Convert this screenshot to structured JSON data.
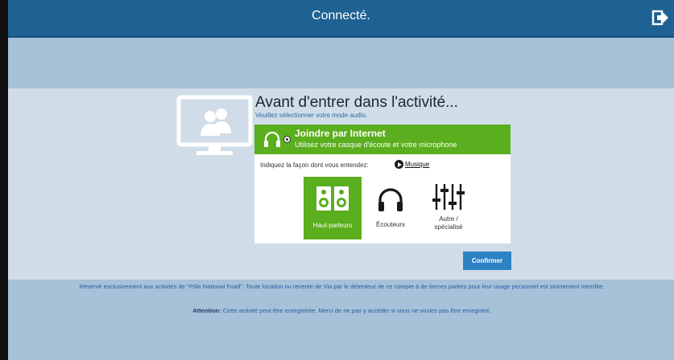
{
  "header": {
    "title": "Connecté."
  },
  "activity": {
    "title": "Avant d'entrer dans l'activité...",
    "subtitle": "Veuillez sélectionner votre mode audio."
  },
  "join_option": {
    "title": "Joindre par Internet",
    "subtitle": "Utilisez votre casque d'écoute et votre microphone",
    "selected": true
  },
  "hearing": {
    "prompt": "Indiquez la façon dont vous entendez:",
    "test_link": "Musique",
    "options": [
      {
        "label": "Haut-parleurs",
        "icon": "speakers-icon",
        "selected": true
      },
      {
        "label": "Écouteurs",
        "icon": "headphones-icon",
        "selected": false
      },
      {
        "label": "Autre /",
        "label2": "spécialisé",
        "icon": "sliders-icon",
        "selected": false
      }
    ]
  },
  "confirm_label": "Confirmer",
  "footer": {
    "disclaimer": "Réservé exclusivement aux activités de \"Pôle National Foad\". Toute location ou revente de Via par le détenteur de ce compte à de tierces parties pour leur usage personnel est strictement interdite.",
    "attention_label": "Attention:",
    "attention_text": " Cette activité peut être enregistrée. Merci de ne pas y accéder si vous ne voulez pas être enregistré."
  },
  "colors": {
    "topbar": "#1e6193",
    "accent_green": "#5bae1d",
    "confirm_blue": "#2d82c2",
    "background": "#a6c0d8",
    "panel": "#d0dde8"
  }
}
